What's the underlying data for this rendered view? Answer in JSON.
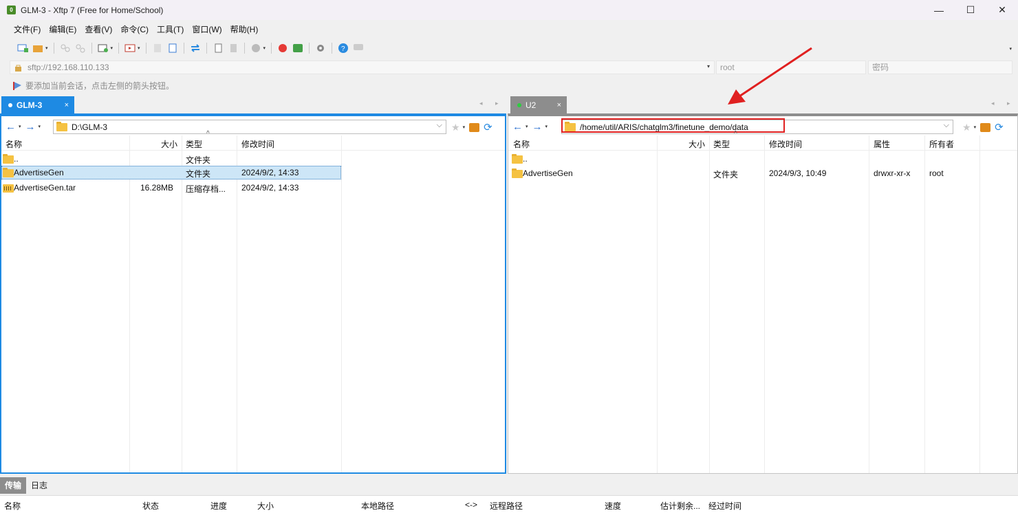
{
  "window": {
    "title": "GLM-3 - Xftp 7 (Free for Home/School)",
    "icon_glyph": "0",
    "controls": {
      "minimize": "—",
      "maximize": "☐",
      "close": "✕"
    }
  },
  "menu": [
    "文件(F)",
    "编辑(E)",
    "查看(V)",
    "命令(C)",
    "工具(T)",
    "窗口(W)",
    "帮助(H)"
  ],
  "address": {
    "url": "sftp://192.168.110.133",
    "user_placeholder": "root",
    "password_placeholder": "密码",
    "dropdown_glyph": "▾"
  },
  "hint": "要添加当前会话，点击左侧的箭头按钮。",
  "tabs": {
    "left": {
      "label": "GLM-3",
      "close": "×",
      "dot_color": "#ffffff"
    },
    "right": {
      "label": "U2",
      "close": "×",
      "dot_color": "#2ecc40"
    },
    "scroll_glyphs": "◂ ▸"
  },
  "left_pane": {
    "path": "D:\\GLM-3",
    "columns": [
      "名称",
      "大小",
      "类型",
      "修改时间"
    ],
    "rows": [
      {
        "name": "..",
        "size": "",
        "type": "文件夹",
        "modified": "",
        "icon": "folder-icon"
      },
      {
        "name": "AdvertiseGen",
        "size": "",
        "type": "文件夹",
        "modified": "2024/9/2, 14:33",
        "icon": "folder-icon",
        "selected": true
      },
      {
        "name": "AdvertiseGen.tar",
        "size": "16.28MB",
        "type": "压缩存档...",
        "modified": "2024/9/2, 14:33",
        "icon": "archive-icon"
      }
    ]
  },
  "right_pane": {
    "path": "/home/util/ARIS/chatglm3/finetune_demo/data",
    "columns": [
      "名称",
      "大小",
      "类型",
      "修改时间",
      "属性",
      "所有者"
    ],
    "rows": [
      {
        "name": "..",
        "size": "",
        "type": "",
        "modified": "",
        "attrs": "",
        "owner": "",
        "icon": "folder-icon"
      },
      {
        "name": "AdvertiseGen",
        "size": "",
        "type": "文件夹",
        "modified": "2024/9/3, 10:49",
        "attrs": "drwxr-xr-x",
        "owner": "root",
        "icon": "folder-icon"
      }
    ]
  },
  "bottom": {
    "tabs": [
      "传输",
      "日志"
    ],
    "columns": [
      "名称",
      "状态",
      "进度",
      "大小",
      "本地路径",
      "<->",
      "远程路径",
      "速度",
      "估计剩余...",
      "经过时间"
    ]
  },
  "glyphs": {
    "nav_back": "←",
    "nav_fwd": "→",
    "dd": "▾",
    "path_dd": "⌵",
    "star": "★",
    "refresh": "⟳",
    "sort_caret": "^",
    "tb_more": "▾"
  },
  "colors": {
    "accent": "#1e8ae3",
    "highlight_box": "#e02020",
    "tab_inactive": "#8d8d8d"
  }
}
